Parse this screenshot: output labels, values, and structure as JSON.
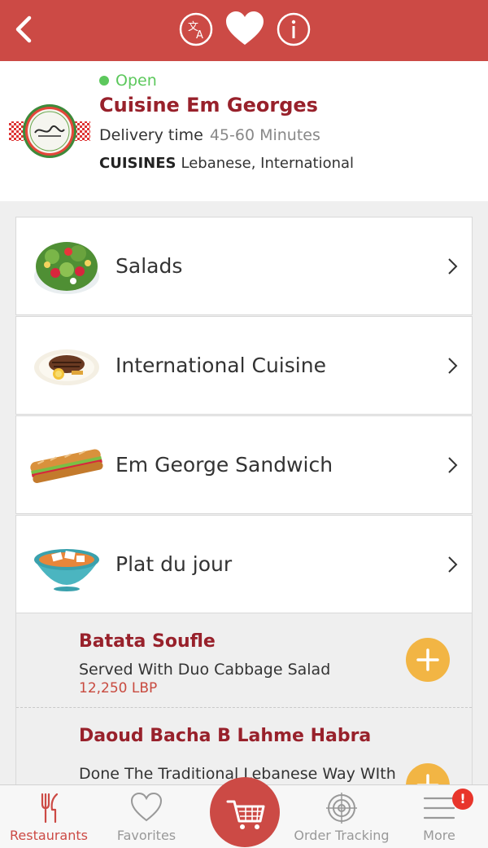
{
  "colors": {
    "brand": "#cc4a45",
    "name": "#98212b",
    "open": "#5cc85c",
    "accent": "#f2b544",
    "price": "#c84a3f"
  },
  "topbar": {
    "back_icon": "chevron-left-icon",
    "icons": [
      "translate-icon",
      "favorite-heart-icon",
      "info-icon"
    ]
  },
  "restaurant": {
    "status": "Open",
    "name": "Cuisine Em Georges",
    "delivery_label": "Delivery time",
    "delivery_value": "45-60 Minutes",
    "cuisines_label": "CUISINES",
    "cuisines_value": "Lebanese, International"
  },
  "categories": [
    {
      "label": "Salads",
      "icon": "salad-icon"
    },
    {
      "label": "International Cuisine",
      "icon": "steak-plate-icon"
    },
    {
      "label": "Em George Sandwich",
      "icon": "sandwich-icon"
    },
    {
      "label": "Plat du jour",
      "icon": "soup-bowl-icon"
    }
  ],
  "dishes": [
    {
      "name": "Batata Soufle",
      "description": "Served With Duo Cabbage Salad",
      "price": "12,250 LBP"
    },
    {
      "name": "Daoud Bacha B Lahme Habra",
      "description": "Done The Traditional Lebanese Way WIth",
      "price": ""
    }
  ],
  "tabs": [
    {
      "label": "Restaurants",
      "icon": "fork-knife-icon",
      "active": true
    },
    {
      "label": "Favorites",
      "icon": "heart-outline-icon",
      "active": false
    },
    {
      "label": "",
      "icon": "cart-icon",
      "active": false
    },
    {
      "label": "Order Tracking",
      "icon": "target-icon",
      "active": false
    },
    {
      "label": "More",
      "icon": "menu-icon",
      "active": false
    }
  ],
  "more_badge": "!"
}
